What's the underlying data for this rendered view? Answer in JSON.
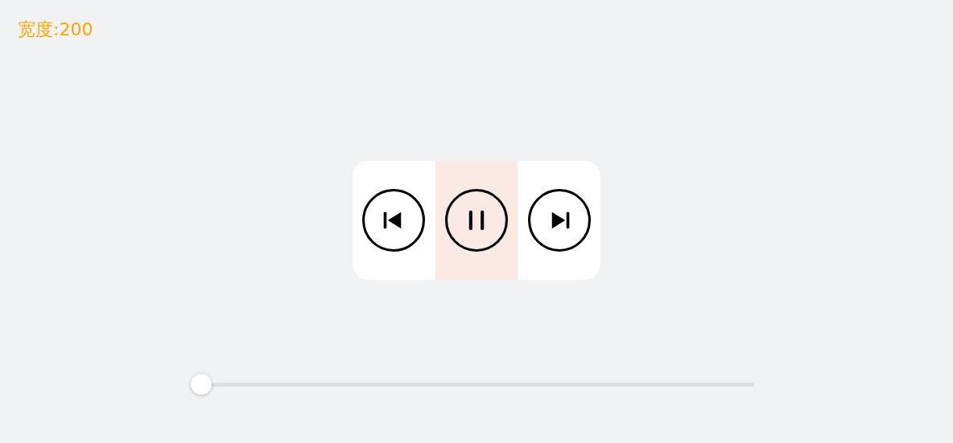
{
  "width_label": "宽度:200",
  "controls": [
    {
      "kind": "previous",
      "selected": false
    },
    {
      "kind": "pause",
      "selected": true
    },
    {
      "kind": "next",
      "selected": false
    }
  ],
  "slider": {
    "level": 0
  }
}
